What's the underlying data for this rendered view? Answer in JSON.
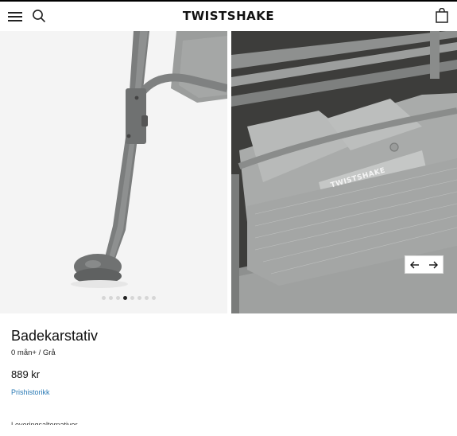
{
  "header": {
    "logo_text": "TWISTSHAKE",
    "menu_icon": "hamburger-menu-icon",
    "search_icon": "search-icon",
    "bag_icon": "shopping-bag-icon"
  },
  "gallery": {
    "image_left_alt": "stand leg close-up",
    "image_right_alt": "bath stand storage basket",
    "image_right_brand": "TWISTSHAKE",
    "dot_count": 8,
    "active_dot": 4,
    "prev_icon": "arrow-left-icon",
    "next_icon": "arrow-right-icon",
    "colors": {
      "left_bg": "#f4f4f4",
      "right_bg": "#3d3d3b",
      "product_gray": "#8a8c8c"
    }
  },
  "product": {
    "name": "Badekarstativ",
    "variant": "0 mån+ / Grå",
    "price": "889 kr",
    "price_history_link": "Prishistorikk",
    "cutoff_text": "Leveringsalternativer"
  },
  "colors": {
    "link": "#2a7ab5",
    "text": "#111111"
  }
}
